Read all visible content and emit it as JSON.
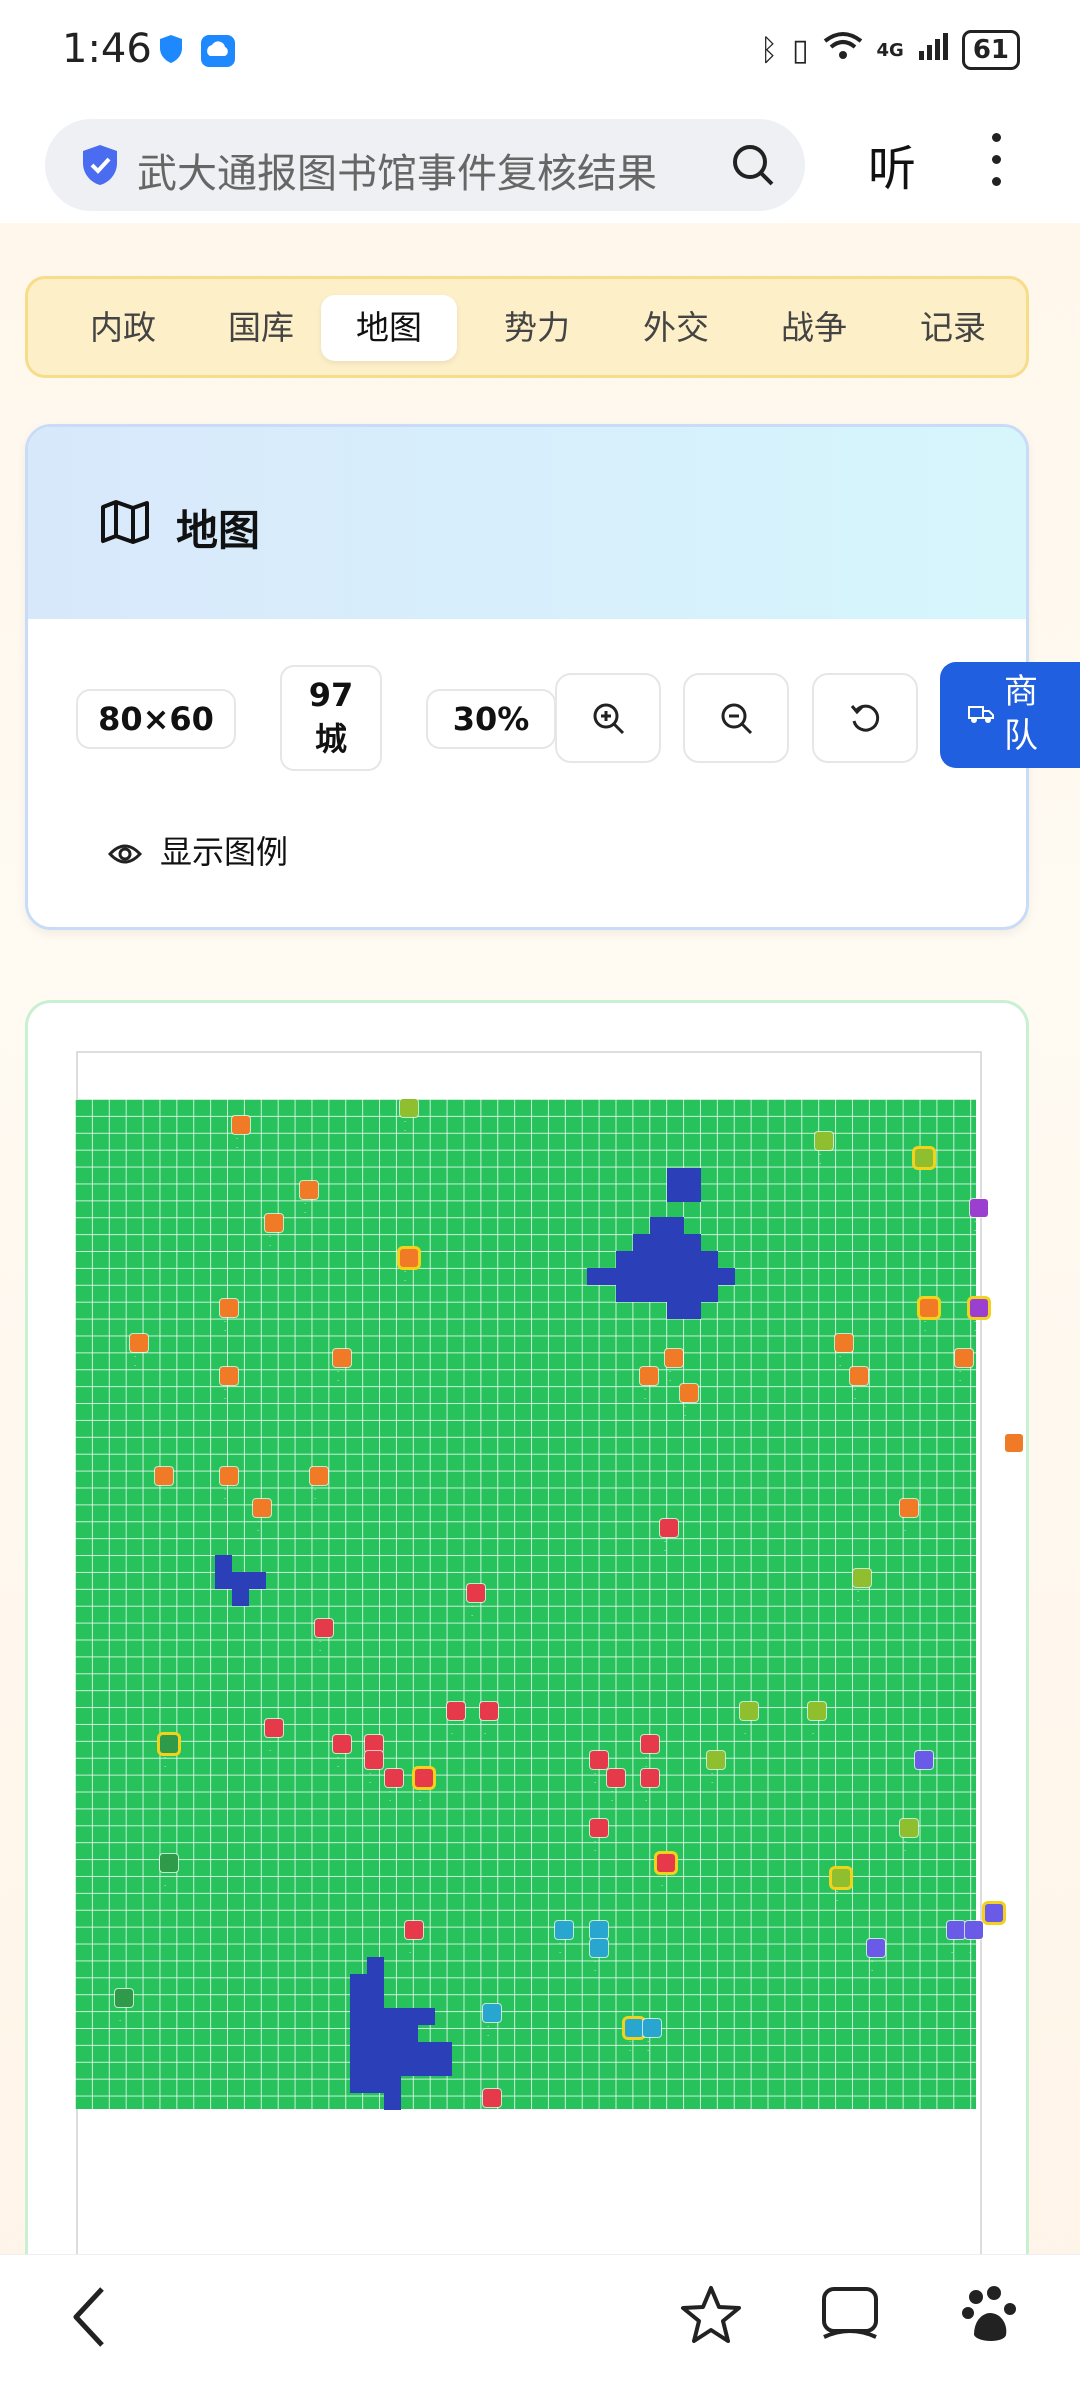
{
  "status": {
    "time": "1:46",
    "battery": "61",
    "network": "4G"
  },
  "search": {
    "query": "武大通报图书馆事件复核结果",
    "listen_label": "听"
  },
  "tabs": [
    {
      "label": "内政"
    },
    {
      "label": "国库"
    },
    {
      "label": "地图",
      "active": true
    },
    {
      "label": "势力"
    },
    {
      "label": "外交"
    },
    {
      "label": "战争"
    },
    {
      "label": "记录"
    }
  ],
  "map_panel": {
    "title": "地图",
    "size_label": "80×60",
    "city_count_number": "97",
    "city_count_unit": "城",
    "zoom_label": "30%",
    "caravan_label": "商队",
    "legend_label": "显示图例"
  },
  "colors": {
    "land": "#27c25c",
    "water": "#2b40b8",
    "faction_orange": "#f07a26",
    "faction_red": "#e63a4a",
    "faction_olive": "#8fbf2e",
    "faction_purple": "#9a3fd0",
    "faction_cyan": "#29a6d0",
    "faction_violet": "#6a5ae8",
    "faction_green": "#2e9a4a",
    "capital_border": "#f2d21b"
  },
  "icons": [
    "shield-icon",
    "search-icon",
    "more-icon",
    "map-icon",
    "zoom-in-icon",
    "zoom-out-icon",
    "reset-icon",
    "truck-icon",
    "eye-icon",
    "back-icon",
    "star-icon",
    "book-icon",
    "paw-icon"
  ]
}
